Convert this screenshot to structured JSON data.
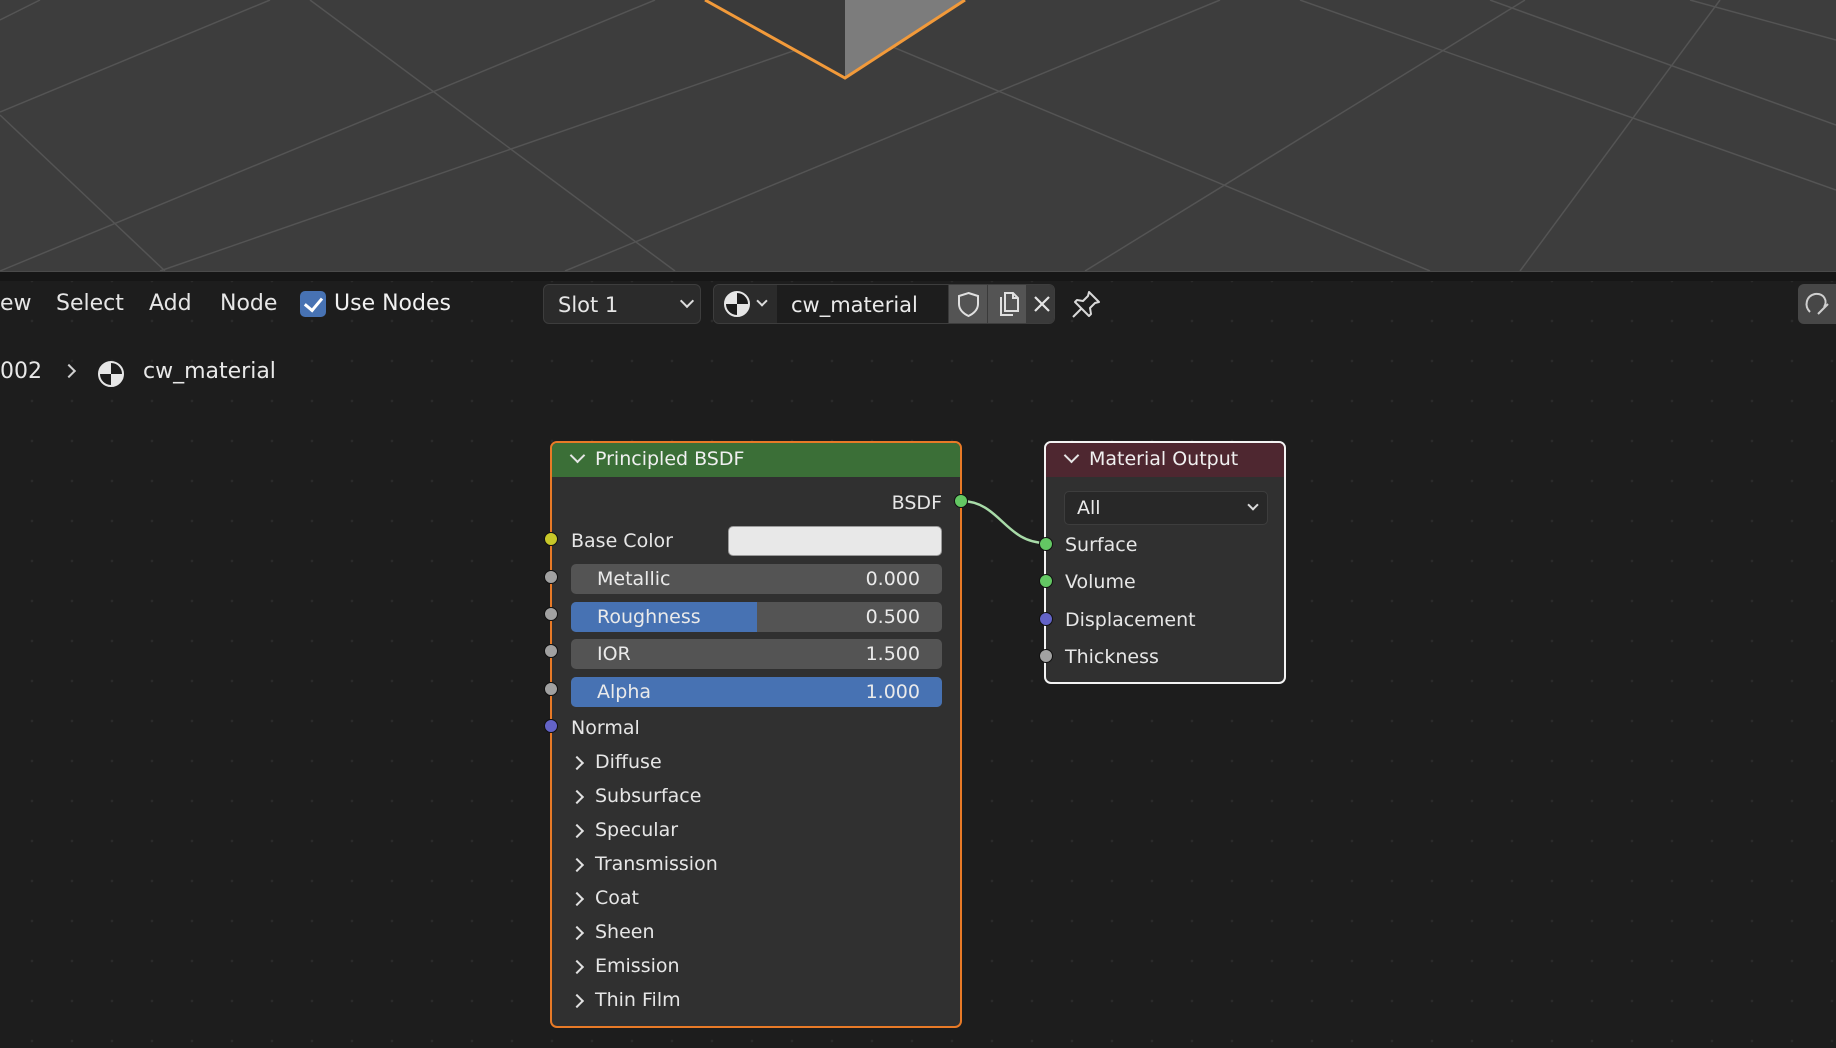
{
  "header": {
    "menu": [
      "ew",
      "Select",
      "Add",
      "Node"
    ],
    "use_nodes_label": "Use Nodes",
    "use_nodes_checked": true,
    "slot_label": "Slot 1",
    "material_name": "cw_material"
  },
  "breadcrumb": {
    "object_label": "002",
    "material_label": "cw_material"
  },
  "bsdf_node": {
    "title": "Principled BSDF",
    "output_label": "BSDF",
    "base_color_label": "Base Color",
    "base_color": "#e8e8e8",
    "fields": [
      {
        "label": "Metallic",
        "value": "0.000",
        "fill": 0.0
      },
      {
        "label": "Roughness",
        "value": "0.500",
        "fill": 0.5
      },
      {
        "label": "IOR",
        "value": "1.500",
        "fill": 0.0
      },
      {
        "label": "Alpha",
        "value": "1.000",
        "fill": 1.0
      }
    ],
    "normal_label": "Normal",
    "panels": [
      "Diffuse",
      "Subsurface",
      "Specular",
      "Transmission",
      "Coat",
      "Sheen",
      "Emission",
      "Thin Film"
    ]
  },
  "output_node": {
    "title": "Material Output",
    "target": "All",
    "inputs": [
      "Surface",
      "Volume",
      "Displacement",
      "Thickness"
    ]
  },
  "colors": {
    "accent": "#4772b3",
    "selection_orange": "#e87a27",
    "shader_socket": "#63c763",
    "vector_socket": "#6363c7",
    "color_socket": "#c7c729",
    "float_socket": "#a1a1a1"
  }
}
